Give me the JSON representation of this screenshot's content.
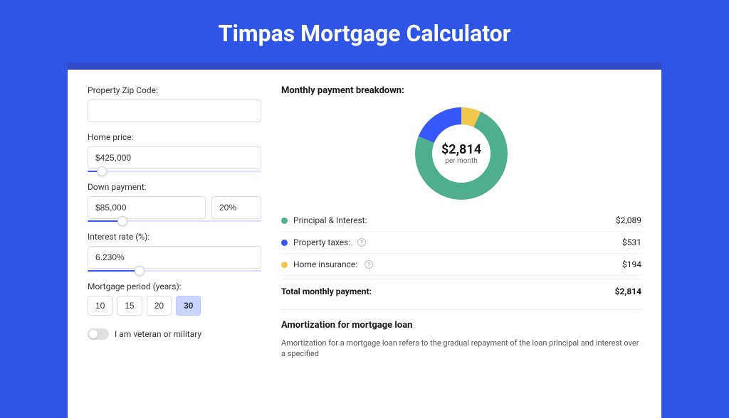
{
  "page_title": "Timpas Mortgage Calculator",
  "left": {
    "zip_label": "Property Zip Code:",
    "zip_value": "",
    "home_price_label": "Home price:",
    "home_price_value": "$425,000",
    "home_price_slider_pct": 8,
    "down_label": "Down payment:",
    "down_value": "$85,000",
    "down_pct": "20%",
    "down_slider_pct": 20,
    "rate_label": "Interest rate (%):",
    "rate_value": "6.230%",
    "rate_slider_pct": 30,
    "period_label": "Mortgage period (years):",
    "period_options": [
      "10",
      "15",
      "20",
      "30"
    ],
    "period_selected": "30",
    "veteran_label": "I am veteran or military",
    "veteran_on": false
  },
  "right": {
    "breakdown_title": "Monthly payment breakdown:",
    "donut_value": "$2,814",
    "donut_sub": "per month",
    "items": [
      {
        "label": "Principal & Interest:",
        "value": "$2,089",
        "color": "green",
        "info": false
      },
      {
        "label": "Property taxes:",
        "value": "$531",
        "color": "blue",
        "info": true
      },
      {
        "label": "Home insurance:",
        "value": "$194",
        "color": "yellow",
        "info": true
      }
    ],
    "total_label": "Total monthly payment:",
    "total_value": "$2,814",
    "amort_title": "Amortization for mortgage loan",
    "amort_text": "Amortization for a mortgage loan refers to the gradual repayment of the loan principal and interest over a specified"
  },
  "chart_data": {
    "type": "pie",
    "title": "Monthly payment breakdown",
    "series": [
      {
        "name": "Principal & Interest",
        "value": 2089
      },
      {
        "name": "Property taxes",
        "value": 531
      },
      {
        "name": "Home insurance",
        "value": 194
      }
    ],
    "total": 2814,
    "center_label": "$2,814 per month"
  }
}
